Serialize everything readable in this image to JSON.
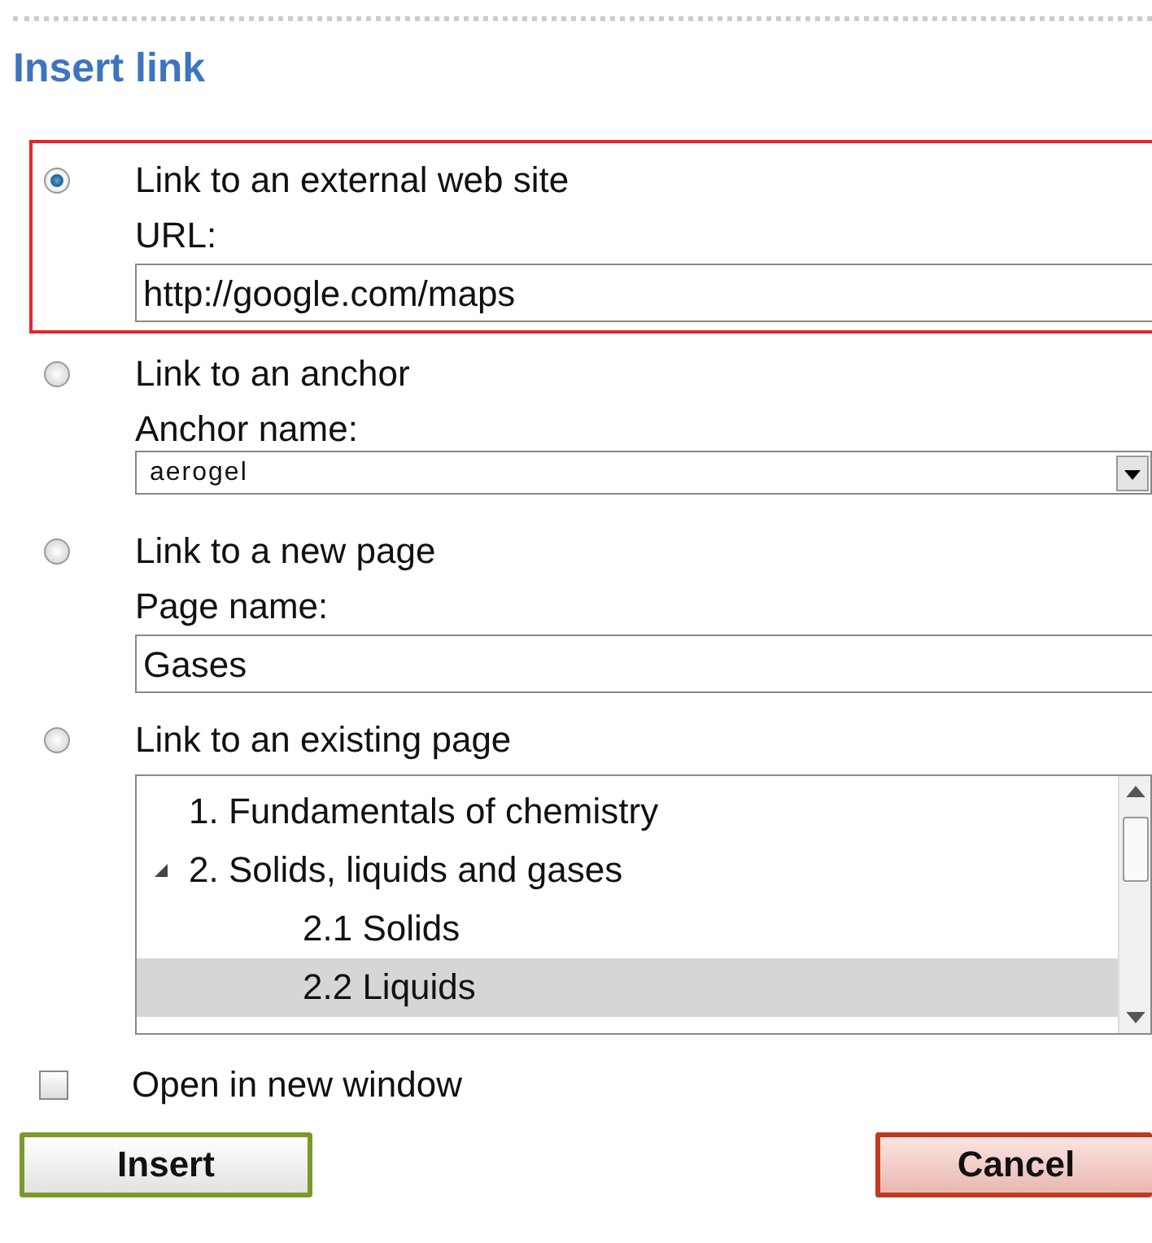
{
  "title": "Insert link",
  "options": [
    {
      "kind": "field",
      "label": "Link to an external web site",
      "selected": true,
      "field_label": "URL:",
      "value": "http://google.com/maps"
    },
    {
      "kind": "dropdown",
      "label": "Link to an anchor",
      "selected": false,
      "field_label": "Anchor name:",
      "value": "aerogel"
    },
    {
      "kind": "field",
      "label": "Link to a new page",
      "selected": false,
      "field_label": "Page name:",
      "value": "Gases"
    },
    {
      "kind": "tree",
      "label": "Link to an existing page",
      "selected": false,
      "items": [
        {
          "label": "1. Fundamentals of chemistry",
          "selected": false
        },
        {
          "label": "2. Solids, liquids and gases",
          "selected": false,
          "expanded": true,
          "children": [
            {
              "label": "2.1 Solids",
              "selected": false
            },
            {
              "label": "2.2 Liquids",
              "selected": true
            }
          ]
        }
      ]
    }
  ],
  "open_in_new_window": {
    "label": "Open in new window",
    "checked": false
  },
  "buttons": [
    {
      "kind": "confirm",
      "label": "Insert"
    },
    {
      "kind": "cancel",
      "label": "Cancel"
    }
  ]
}
